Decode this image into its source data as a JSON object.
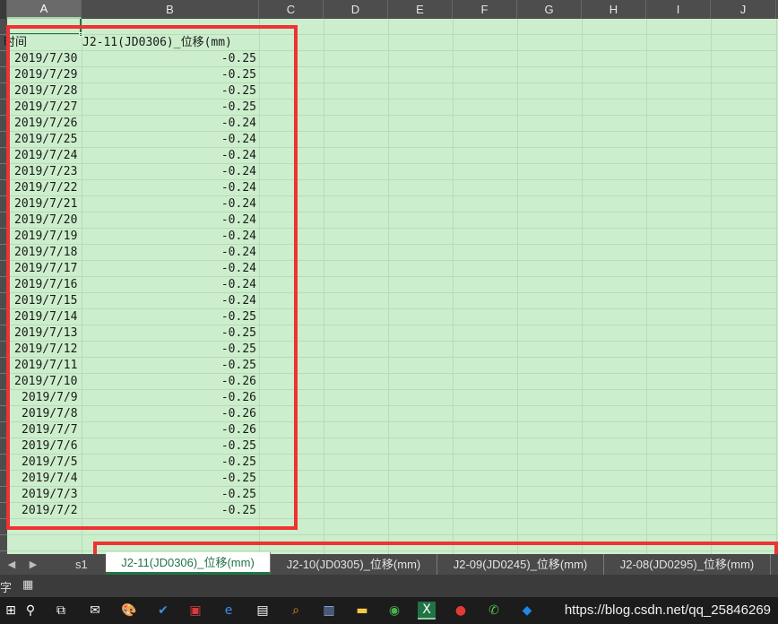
{
  "columns": [
    "A",
    "B",
    "C",
    "D",
    "E",
    "F",
    "G",
    "H",
    "I",
    "J"
  ],
  "sheet": {
    "headers": [
      "时间",
      "J2-11(JD0306)_位移(mm)"
    ],
    "rows": [
      [
        "2019/7/30",
        "-0.25"
      ],
      [
        "2019/7/29",
        "-0.25"
      ],
      [
        "2019/7/28",
        "-0.25"
      ],
      [
        "2019/7/27",
        "-0.25"
      ],
      [
        "2019/7/26",
        "-0.24"
      ],
      [
        "2019/7/25",
        "-0.24"
      ],
      [
        "2019/7/24",
        "-0.24"
      ],
      [
        "2019/7/23",
        "-0.24"
      ],
      [
        "2019/7/22",
        "-0.24"
      ],
      [
        "2019/7/21",
        "-0.24"
      ],
      [
        "2019/7/20",
        "-0.24"
      ],
      [
        "2019/7/19",
        "-0.24"
      ],
      [
        "2019/7/18",
        "-0.24"
      ],
      [
        "2019/7/17",
        "-0.24"
      ],
      [
        "2019/7/16",
        "-0.24"
      ],
      [
        "2019/7/15",
        "-0.24"
      ],
      [
        "2019/7/14",
        "-0.25"
      ],
      [
        "2019/7/13",
        "-0.25"
      ],
      [
        "2019/7/12",
        "-0.25"
      ],
      [
        "2019/7/11",
        "-0.25"
      ],
      [
        "2019/7/10",
        "-0.26"
      ],
      [
        "2019/7/9",
        "-0.26"
      ],
      [
        "2019/7/8",
        "-0.26"
      ],
      [
        "2019/7/7",
        "-0.26"
      ],
      [
        "2019/7/6",
        "-0.25"
      ],
      [
        "2019/7/5",
        "-0.25"
      ],
      [
        "2019/7/4",
        "-0.25"
      ],
      [
        "2019/7/3",
        "-0.25"
      ],
      [
        "2019/7/2",
        "-0.25"
      ]
    ]
  },
  "tabs": {
    "more_label": "s1",
    "items": [
      {
        "label": "J2-11(JD0306)_位移(mm)",
        "active": true
      },
      {
        "label": "J2-10(JD0305)_位移(mm)",
        "active": false
      },
      {
        "label": "J2-09(JD0245)_位移(mm)",
        "active": false
      },
      {
        "label": "J2-08(JD0295)_位移(mm)",
        "active": false
      }
    ]
  },
  "status": {
    "left_text": "字"
  },
  "taskbar": {
    "watermark": "https://blog.csdn.net/qq_25846269"
  },
  "colors": {
    "grid_background": "#cceecc",
    "annotation_red": "#ee3333",
    "excel_green": "#217346"
  }
}
